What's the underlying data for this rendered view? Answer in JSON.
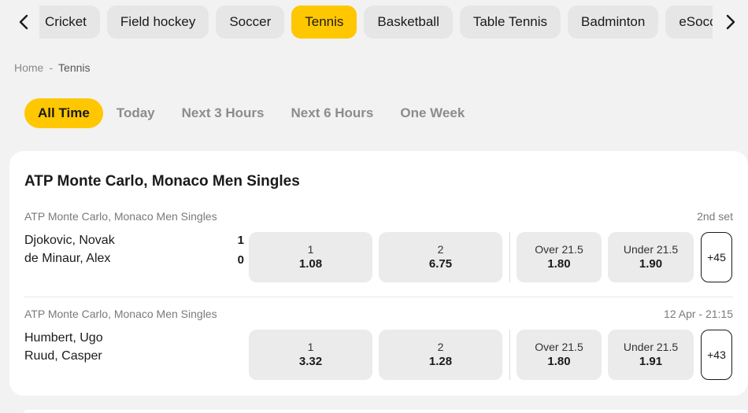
{
  "sports_nav": {
    "items": [
      "Cricket",
      "Field hockey",
      "Soccer",
      "Tennis",
      "Basketball",
      "Table Tennis",
      "Badminton",
      "eSoccer"
    ],
    "active": "Tennis"
  },
  "breadcrumb": {
    "home": "Home",
    "separator": "-",
    "current": "Tennis"
  },
  "time_filters": {
    "items": [
      "All Time",
      "Today",
      "Next 3 Hours",
      "Next 6 Hours",
      "One Week"
    ],
    "active": "All Time"
  },
  "competition": {
    "title": "ATP Monte Carlo, Monaco Men Singles",
    "matches": [
      {
        "league": "ATP Monte Carlo, Monaco Men Singles",
        "status": "2nd set",
        "home": "Djokovic, Novak",
        "away": "de Minaur, Alex",
        "home_score": "1",
        "away_score": "0",
        "odds": [
          {
            "label": "1",
            "value": "1.08"
          },
          {
            "label": "2",
            "value": "6.75"
          },
          {
            "label": "Over 21.5",
            "value": "1.80"
          },
          {
            "label": "Under 21.5",
            "value": "1.90"
          }
        ],
        "more_markets": "+45"
      },
      {
        "league": "ATP Monte Carlo, Monaco Men Singles",
        "status": "12 Apr - 21:15",
        "home": "Humbert, Ugo",
        "away": "Ruud, Casper",
        "home_score": "",
        "away_score": "",
        "odds": [
          {
            "label": "1",
            "value": "3.32"
          },
          {
            "label": "2",
            "value": "1.28"
          },
          {
            "label": "Over 21.5",
            "value": "1.80"
          },
          {
            "label": "Under 21.5",
            "value": "1.91"
          }
        ],
        "more_markets": "+43"
      }
    ]
  },
  "colors": {
    "accent": "#ffc700",
    "background": "#f2f2f2",
    "card": "#ffffff",
    "odd_button": "#ebebeb"
  },
  "icons": {
    "prev": "chevron-left-icon",
    "next": "chevron-right-icon"
  }
}
